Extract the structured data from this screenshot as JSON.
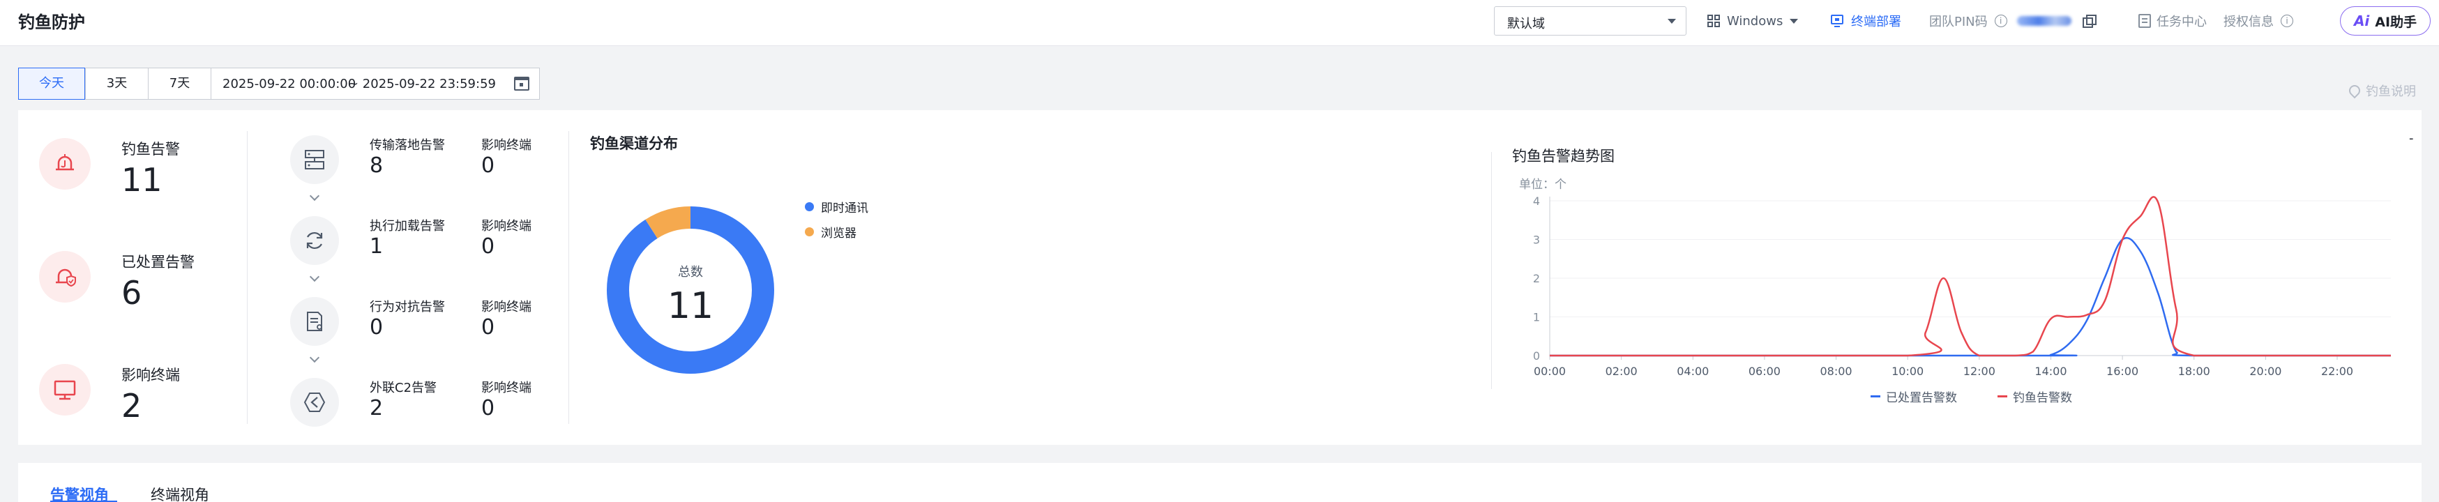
{
  "header": {
    "title": "钓鱼防护",
    "domain_select": "默认域",
    "os_select": "Windows",
    "deploy_link": "终端部署",
    "team_pin_label": "团队PIN码",
    "task_center": "任务中心",
    "license_info": "授权信息",
    "ai_assistant": "AI助手",
    "ai_logo": "Ai"
  },
  "datebar": {
    "tabs": [
      "今天",
      "3天",
      "7天"
    ],
    "active_tab": "今天",
    "range_start": "2025-09-22 00:00:00",
    "range_end": "~ 2025-09-22 23:59:59",
    "help_link": "钓鱼说明"
  },
  "stats": [
    {
      "label": "钓鱼告警",
      "value": "11",
      "icon": "hook-alarm-icon"
    },
    {
      "label": "已处置告警",
      "value": "6",
      "icon": "shield-alarm-icon"
    },
    {
      "label": "影响终端",
      "value": "2",
      "icon": "monitor-icon"
    }
  ],
  "chain": [
    {
      "label": "传输落地告警",
      "value": "8",
      "sub_label": "影响终端",
      "sub_value": "0",
      "icon": "transfer-icon"
    },
    {
      "label": "执行加载告警",
      "value": "1",
      "sub_label": "影响终端",
      "sub_value": "0",
      "icon": "refresh-icon"
    },
    {
      "label": "行为对抗告警",
      "value": "0",
      "sub_label": "影响终端",
      "sub_value": "0",
      "icon": "document-icon"
    },
    {
      "label": "外联C2告警",
      "value": "2",
      "sub_label": "影响终端",
      "sub_value": "0",
      "icon": "network-icon"
    }
  ],
  "distribution": {
    "title": "钓鱼渠道分布",
    "total_label": "总数",
    "total_value": "11",
    "slices": [
      {
        "name": "即时通讯",
        "value": 10,
        "color": "#3a7af5"
      },
      {
        "name": "浏览器",
        "value": 1,
        "color": "#f5a94e"
      }
    ]
  },
  "trend": {
    "title": "钓鱼告警趋势图",
    "unit": "单位：个",
    "corner": "-",
    "legend_handled": "已处置告警数",
    "legend_alarm": "钓鱼告警数"
  },
  "colors": {
    "accent": "#2c6cf6",
    "handled_line": "#2f6bf0",
    "alarm_line": "#e8464e"
  },
  "chart_data": {
    "type": "line",
    "title": "钓鱼告警趋势图",
    "ylabel": "单位：个",
    "ylim": [
      0,
      4
    ],
    "yticks": [
      "0",
      "1",
      "2",
      "3",
      "4"
    ],
    "xlim": [
      0,
      23.5
    ],
    "xticks": [
      "00:00",
      "02:00",
      "04:00",
      "06:00",
      "08:00",
      "10:00",
      "12:00",
      "14:00",
      "16:00",
      "18:00",
      "20:00",
      "22:00"
    ],
    "legend_position": "bottom",
    "series": [
      {
        "name": "已处置告警数",
        "color": "#2f6bf0",
        "x": [
          0,
          13.5,
          14.0,
          14.5,
          15.0,
          15.5,
          16.0,
          16.5,
          17.0,
          17.5,
          18.0,
          23.5
        ],
        "values": [
          0,
          0,
          0.02,
          0.3,
          0.9,
          2.0,
          3.0,
          2.7,
          1.6,
          0.1,
          0,
          0
        ]
      },
      {
        "name": "钓鱼告警数",
        "color": "#e8464e",
        "x": [
          0,
          10.0,
          10.5,
          11.0,
          11.5,
          12.0,
          13.0,
          13.5,
          14.0,
          14.5,
          15.0,
          15.5,
          16.0,
          16.5,
          17.0,
          17.5,
          18.0,
          23.5
        ],
        "values": [
          0,
          0,
          0.6,
          2.0,
          0.6,
          0,
          0,
          0.1,
          0.95,
          1.0,
          1.05,
          1.4,
          3.0,
          3.6,
          3.95,
          1.2,
          0,
          0
        ]
      }
    ]
  }
}
